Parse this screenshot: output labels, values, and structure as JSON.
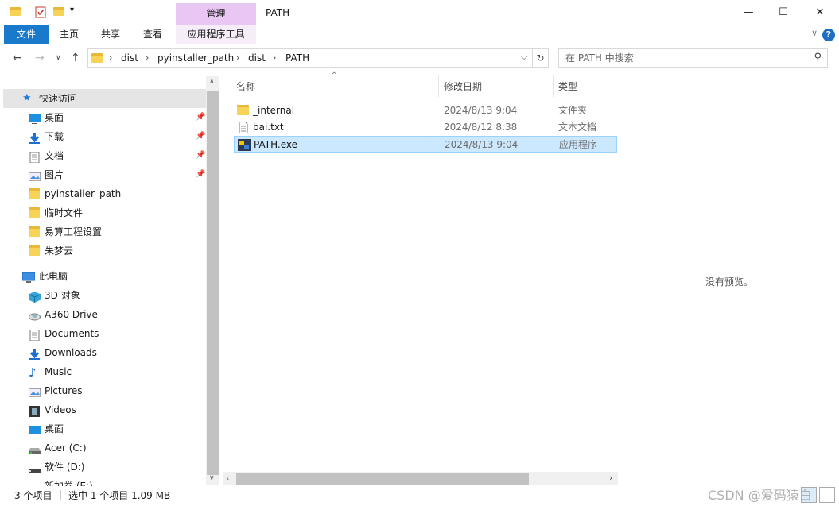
{
  "titlebar": {
    "window_title": "PATH",
    "manage_tab_label": "管理",
    "minimize_glyph": "—",
    "maximize_glyph": "☐",
    "close_glyph": "✕"
  },
  "ribbon": {
    "tabs": [
      {
        "label": "文件"
      },
      {
        "label": "主页"
      },
      {
        "label": "共享"
      },
      {
        "label": "查看"
      },
      {
        "label": "应用程序工具"
      }
    ],
    "help_glyph": "?",
    "collapse_glyph": "∨"
  },
  "address": {
    "crumbs": [
      "dist",
      "pyinstaller_path",
      "dist",
      "PATH"
    ],
    "refresh_glyph": "↻",
    "dropdown_glyph": "⌵"
  },
  "search": {
    "placeholder": "在 PATH 中搜索"
  },
  "navpane": {
    "quick_access": {
      "label": "快速访问",
      "items": [
        {
          "label": "桌面",
          "icon": "desktop-icon",
          "pinned": true
        },
        {
          "label": "下载",
          "icon": "download-icon",
          "pinned": true
        },
        {
          "label": "文档",
          "icon": "document-icon",
          "pinned": true
        },
        {
          "label": "图片",
          "icon": "picture-icon",
          "pinned": true
        },
        {
          "label": "pyinstaller_path",
          "icon": "folder-icon",
          "pinned": false
        },
        {
          "label": "临时文件",
          "icon": "folder-icon",
          "pinned": false
        },
        {
          "label": "易算工程设置",
          "icon": "folder-icon",
          "pinned": false
        },
        {
          "label": "朱梦云",
          "icon": "folder-icon",
          "pinned": false
        }
      ]
    },
    "this_pc": {
      "label": "此电脑",
      "items": [
        {
          "label": "3D 对象",
          "icon": "cube-icon"
        },
        {
          "label": "A360 Drive",
          "icon": "cloud-drive-icon"
        },
        {
          "label": "Documents",
          "icon": "document-icon"
        },
        {
          "label": "Downloads",
          "icon": "download-icon"
        },
        {
          "label": "Music",
          "icon": "music-icon"
        },
        {
          "label": "Pictures",
          "icon": "picture-icon"
        },
        {
          "label": "Videos",
          "icon": "video-icon"
        },
        {
          "label": "桌面",
          "icon": "desktop-icon"
        },
        {
          "label": "Acer (C:)",
          "icon": "drive-icon"
        },
        {
          "label": "软件 (D:)",
          "icon": "drive-icon"
        },
        {
          "label": "新加卷 (E:)",
          "icon": "drive-icon"
        }
      ]
    }
  },
  "filelist": {
    "columns": {
      "name": "名称",
      "date": "修改日期",
      "type": "类型"
    },
    "sort_glyph": "^",
    "rows": [
      {
        "name": "_internal",
        "date": "2024/8/13 9:04",
        "type": "文件夹",
        "icon": "folder-icon",
        "selected": false
      },
      {
        "name": "bai.txt",
        "date": "2024/8/12 8:38",
        "type": "文本文档",
        "icon": "text-file-icon",
        "selected": false
      },
      {
        "name": "PATH.exe",
        "date": "2024/8/13 9:04",
        "type": "应用程序",
        "icon": "exe-icon",
        "selected": true
      }
    ]
  },
  "preview": {
    "text": "没有预览。"
  },
  "status": {
    "count": "3 个项目",
    "selection": "选中 1 个项目  1.09 MB"
  },
  "watermark": "CSDN @爱码猿白",
  "colors": {
    "accent": "#1979ca",
    "selection": "#cce8ff",
    "manage_tab": "#e9c7f4"
  }
}
